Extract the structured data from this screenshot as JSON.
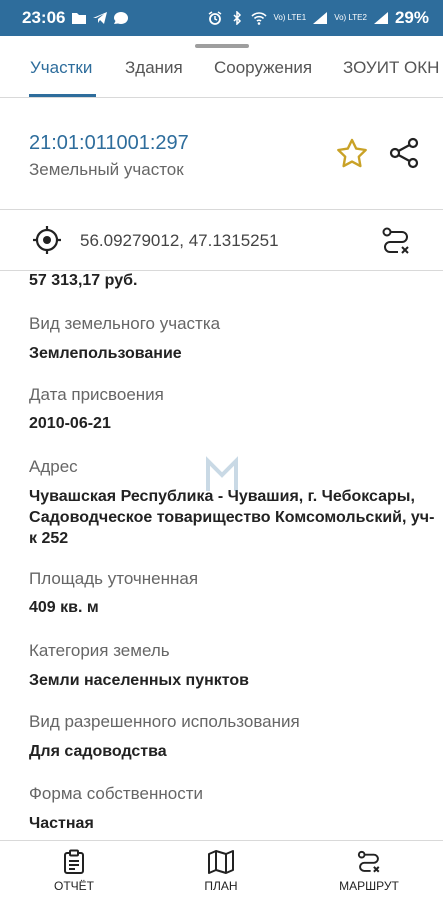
{
  "status_bar": {
    "time": "23:06",
    "battery": "29%",
    "sim1": "Vo) LTE1",
    "sim2": "Vo) LTE2"
  },
  "tabs": [
    {
      "label": "Участки",
      "active": true
    },
    {
      "label": "Здания",
      "active": false
    },
    {
      "label": "Сооружения",
      "active": false
    },
    {
      "label": "ЗОУИТ ОКН",
      "active": false
    }
  ],
  "header": {
    "cadastral_number": "21:01:011001:297",
    "object_type": "Земельный участок"
  },
  "coordinates": "56.09279012, 47.1315251",
  "fields": [
    {
      "label": "",
      "value": "57 313,17 руб."
    },
    {
      "label": "Вид земельного участка",
      "value": "Землепользование"
    },
    {
      "label": "Дата присвоения",
      "value": "2010-06-21"
    },
    {
      "label": "Адрес",
      "value": "Чувашская Республика - Чувашия, г. Чебоксары, Садоводческое товарищество Комсомольский, уч-к 252"
    },
    {
      "label": "Площадь уточненная",
      "value": "409 кв. м"
    },
    {
      "label": "Категория земель",
      "value": "Земли населенных пунктов"
    },
    {
      "label": "Вид разрешенного использования",
      "value": "Для садоводства"
    },
    {
      "label": "Форма собственности",
      "value": "Частная"
    }
  ],
  "bottom_nav": [
    {
      "label": "ОТЧЁТ",
      "icon": "report-icon"
    },
    {
      "label": "ПЛАН",
      "icon": "map-icon"
    },
    {
      "label": "МАРШРУТ",
      "icon": "route-icon"
    }
  ],
  "colors": {
    "primary": "#2e6d9c",
    "star": "#c9a227",
    "text": "#222222",
    "secondary_text": "#666666"
  }
}
